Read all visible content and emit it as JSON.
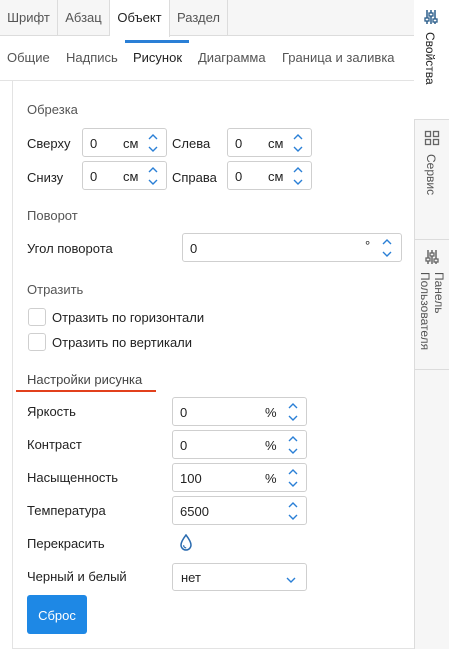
{
  "top_tabs": [
    "Шрифт",
    "Абзац",
    "Объект",
    "Раздел"
  ],
  "sub_tabs": [
    "Общие",
    "Надпись",
    "Рисунок",
    "Диаграмма",
    "Граница и заливка"
  ],
  "crop": {
    "title": "Обрезка",
    "top_label": "Сверху",
    "top_value": "0",
    "top_unit": "см",
    "left_label": "Слева",
    "left_value": "0",
    "left_unit": "см",
    "bottom_label": "Снизу",
    "bottom_value": "0",
    "bottom_unit": "см",
    "right_label": "Справа",
    "right_value": "0",
    "right_unit": "см"
  },
  "rotation": {
    "title": "Поворот",
    "angle_label": "Угол поворота",
    "angle_value": "0",
    "angle_unit": "°"
  },
  "flip": {
    "title": "Отразить",
    "horizontal_label": "Отразить по горизонтали",
    "vertical_label": "Отразить по вертикали"
  },
  "image_settings": {
    "title": "Настройки рисунка",
    "brightness_label": "Яркость",
    "brightness_value": "0",
    "brightness_unit": "%",
    "contrast_label": "Контраст",
    "contrast_value": "0",
    "contrast_unit": "%",
    "saturation_label": "Насыщенность",
    "saturation_value": "100",
    "saturation_unit": "%",
    "temperature_label": "Температура",
    "temperature_value": "6500",
    "recolor_label": "Перекрасить",
    "bw_label": "Черный и белый",
    "bw_value": "нет",
    "reset_label": "Сброс"
  },
  "side_rail": {
    "properties": "Свойства",
    "service": "Сервис",
    "user_panel_line1": "Панель",
    "user_panel_line2": "Пользователя"
  },
  "colors": {
    "accent_blue": "#1e88e5",
    "section_underline": "#e2401c",
    "tab_underline": "#2a7fd6"
  }
}
